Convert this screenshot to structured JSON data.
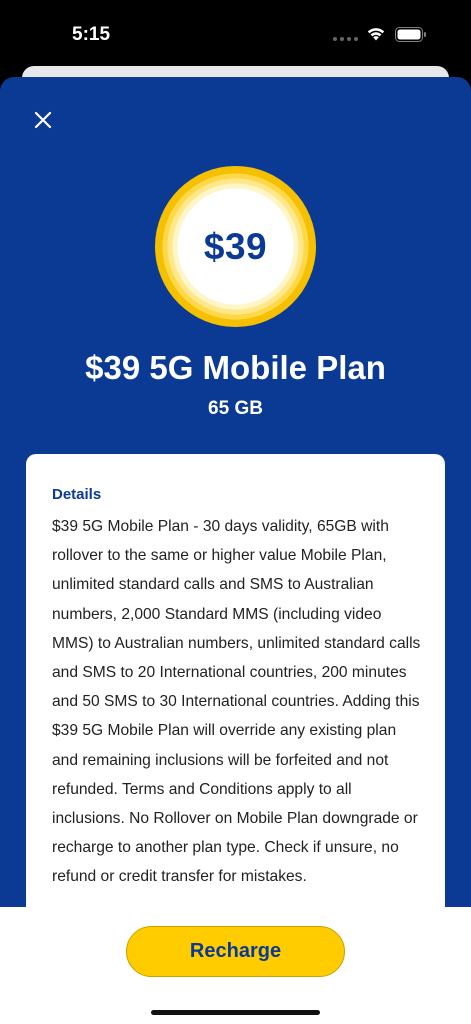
{
  "status_bar": {
    "time": "5:15",
    "icons": [
      "signal-dots-icon",
      "wifi-icon",
      "battery-icon"
    ]
  },
  "modal": {
    "close_icon": "close-icon",
    "badge_price": "$39",
    "plan_title": "$39 5G Mobile Plan",
    "plan_data": "65 GB",
    "details": {
      "heading": "Details",
      "body": "$39 5G Mobile Plan - 30 days validity, 65GB with rollover to the same or higher value Mobile Plan, unlimited standard calls and SMS to Australian numbers, 2,000 Standard MMS (including video MMS) to Australian numbers, unlimited standard calls and SMS to 20 International countries, 200 minutes and 50 SMS to 30 International countries. Adding this $39 5G Mobile Plan will override any existing plan and remaining inclusions will be forfeited and not refunded. Terms and Conditions apply to all inclusions. No Rollover on Mobile Plan downgrade or recharge to another plan type. Check if unsure, no refund or credit transfer for mistakes."
    }
  },
  "footer": {
    "recharge_label": "Recharge"
  },
  "colors": {
    "brand_blue": "#0a3a94",
    "accent_yellow": "#ffcc00"
  }
}
